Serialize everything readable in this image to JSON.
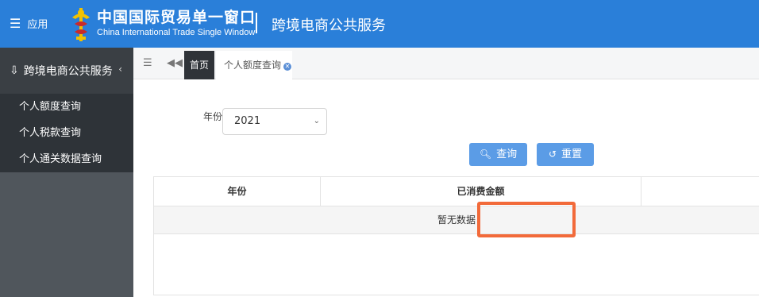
{
  "header": {
    "app_menu_label": "应用",
    "brand_cn": "中国国际贸易单一窗口",
    "brand_en": "China International Trade Single Window",
    "service_title": "跨境电商公共服务",
    "color": "#2a7fd9"
  },
  "sidebar": {
    "title": "跨境电商公共服务",
    "items": [
      {
        "label": "个人额度查询"
      },
      {
        "label": "个人税款查询"
      },
      {
        "label": "个人通关数据查询"
      }
    ]
  },
  "tabs": {
    "home": "首页",
    "current": "个人额度查询"
  },
  "filter": {
    "year_label": "年份",
    "year_value": "2021",
    "search_label": "查询",
    "reset_label": "重置"
  },
  "table": {
    "columns": [
      "年份",
      "已消费金额",
      ""
    ],
    "empty_text": "暂无数据"
  },
  "highlight": {
    "color": "#f26a3a"
  },
  "icons": {
    "app_menu": "menu-icon",
    "logo": "customs-emblem-icon",
    "sidebar_head": "sidebar-head-icon",
    "collapse": "chevron-left-icon",
    "tab_menu": "menu-icon",
    "tab_back": "rewind-icon",
    "tab_close": "close-icon",
    "search": "search-icon",
    "reset": "reset-icon"
  }
}
